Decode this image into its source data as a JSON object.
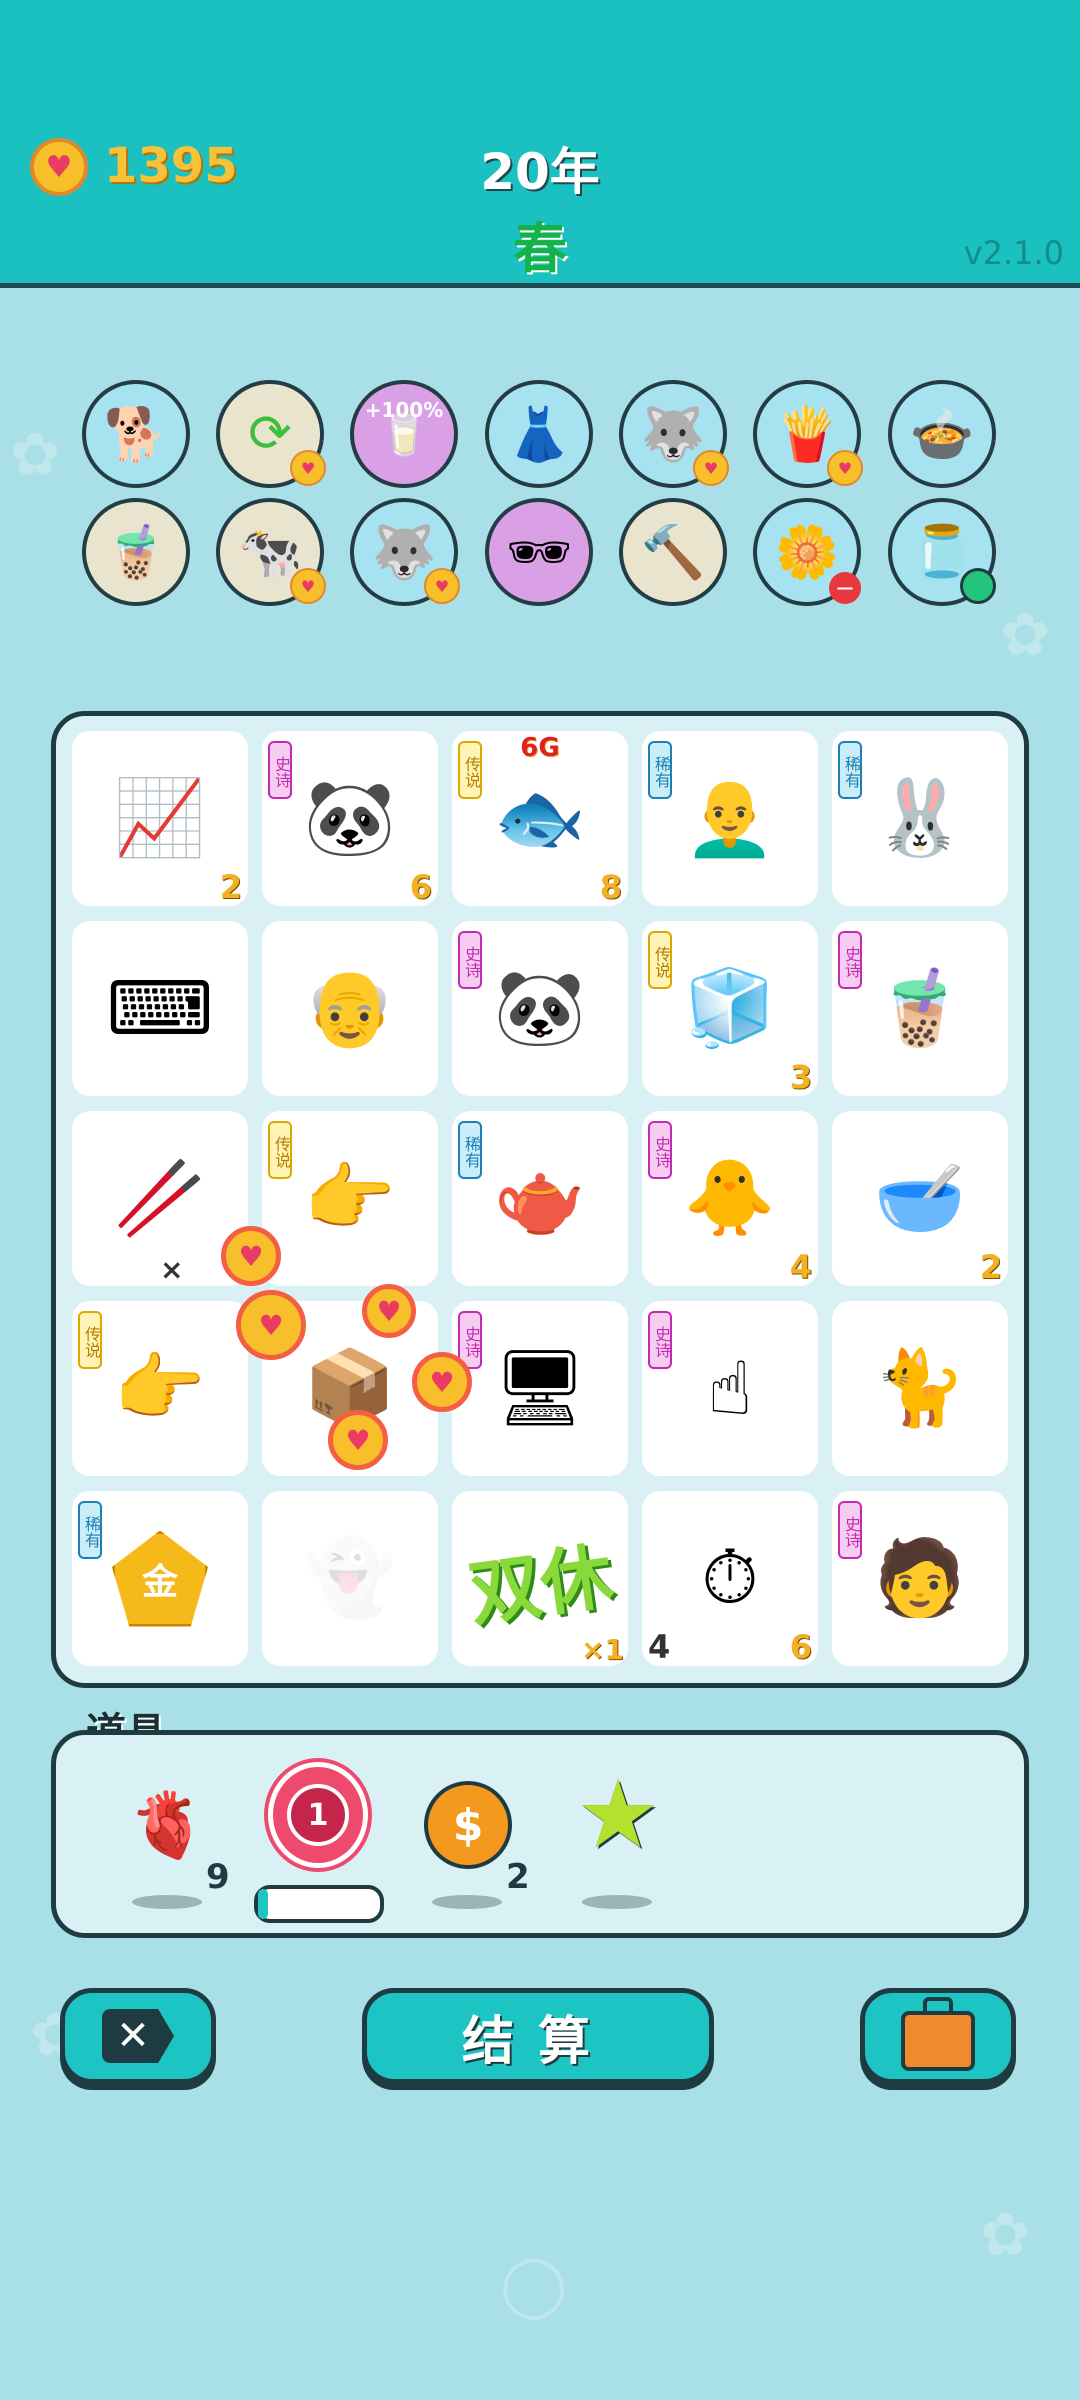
{
  "header": {
    "coins": "1395",
    "year": "20年",
    "season": "春",
    "version": "v2.1.0"
  },
  "items_row1": [
    "cat-king",
    "refresh",
    "+100%",
    "skirt",
    "husky",
    "fries",
    "duck-pot"
  ],
  "items_row2": [
    "milk-tea",
    "cow-pair",
    "husky-2",
    "sunglasses",
    "hammer",
    "flower",
    "tea-bag"
  ],
  "board": {
    "tags": {
      "epic": "史诗",
      "legend": "传说",
      "rare": "稀有"
    },
    "cells": [
      {
        "icon": "chart-icon",
        "tag": null,
        "count": "2"
      },
      {
        "icon": "panda-icon",
        "tag": "epic",
        "count": "6"
      },
      {
        "icon": "koi-icon",
        "tag": "legend",
        "count": "8",
        "top_label": "6G"
      },
      {
        "icon": "bald-man-icon",
        "tag": "rare",
        "count": ""
      },
      {
        "icon": "rabbit-icon",
        "tag": "rare",
        "count": ""
      },
      {
        "icon": "keyboard-icon",
        "tag": null,
        "count": ""
      },
      {
        "icon": "glasses-man-icon",
        "tag": null,
        "count": ""
      },
      {
        "icon": "panda-icon",
        "tag": "epic",
        "count": ""
      },
      {
        "icon": "fridge-icon",
        "tag": "legend",
        "count": "3"
      },
      {
        "icon": "bubble-tea-icon",
        "tag": "epic",
        "count": ""
      },
      {
        "icon": "straw-icon",
        "tag": null,
        "count": "",
        "multiplier": "×"
      },
      {
        "icon": "hand-icon",
        "tag": "legend",
        "count": ""
      },
      {
        "icon": "teapot-icon",
        "tag": "rare",
        "count": ""
      },
      {
        "icon": "chick-icon",
        "tag": "epic",
        "count": "4"
      },
      {
        "icon": "bowl-icon",
        "tag": null,
        "count": "2"
      },
      {
        "icon": "hand-icon",
        "tag": "legend",
        "count": ""
      },
      {
        "icon": "box-icon",
        "tag": null,
        "count": ""
      },
      {
        "icon": "gpu-icon",
        "tag": "epic",
        "count": ""
      },
      {
        "icon": "finger-icon",
        "tag": "epic",
        "count": ""
      },
      {
        "icon": "cat-icon",
        "tag": null,
        "count": ""
      },
      {
        "icon": "gold-icon",
        "tag": "rare",
        "count": "",
        "gold": "金"
      },
      {
        "icon": "ghost-icon",
        "tag": null,
        "count": ""
      },
      {
        "icon": "double-rest-icon",
        "tag": null,
        "count": "",
        "overlay": "双休",
        "mult": "×1"
      },
      {
        "icon": "stopwatch-icon",
        "tag": null,
        "count": "6",
        "left": "4"
      },
      {
        "icon": "black-hair-man-icon",
        "tag": "epic",
        "count": ""
      }
    ]
  },
  "props": {
    "label": "道具",
    "items": [
      {
        "icon": "liver-icon",
        "count": "9"
      },
      {
        "icon": "target-icon",
        "count": "1"
      },
      {
        "icon": "dollar-coin-icon",
        "count": "2"
      },
      {
        "icon": "star-icon",
        "count": ""
      }
    ]
  },
  "buttons": {
    "settle": "结算"
  },
  "colors": {
    "header": "#1bc1c1",
    "background": "#a9dfe6",
    "outline": "#1f3b42",
    "coin": "#f7c02b"
  }
}
